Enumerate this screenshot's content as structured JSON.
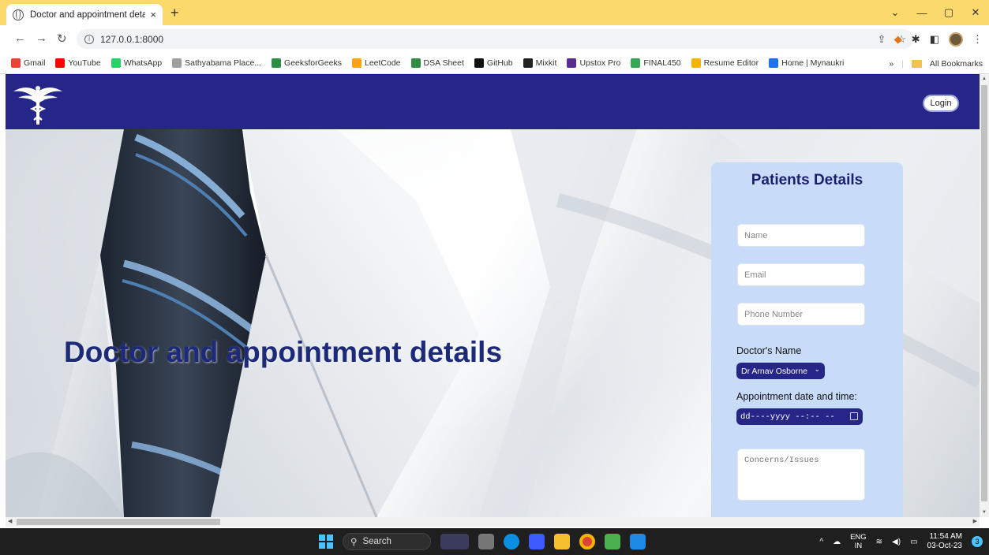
{
  "browser": {
    "tab_title": "Doctor and appointment details",
    "tab_close": "×",
    "new_tab": "+",
    "url": "127.0.0.1:8000",
    "bookmarks": [
      {
        "label": "Gmail",
        "color": "#ea4335"
      },
      {
        "label": "YouTube",
        "color": "#ff0000"
      },
      {
        "label": "WhatsApp",
        "color": "#25d366"
      },
      {
        "label": "Sathyabama Place...",
        "color": "#9e9e9e"
      },
      {
        "label": "GeeksforGeeks",
        "color": "#2f8d46"
      },
      {
        "label": "LeetCode",
        "color": "#ffa116"
      },
      {
        "label": "DSA Sheet",
        "color": "#2f8d46"
      },
      {
        "label": "GitHub",
        "color": "#111111"
      },
      {
        "label": "Mixkit",
        "color": "#222222"
      },
      {
        "label": "Upstox Pro",
        "color": "#5a2d91"
      },
      {
        "label": "FINAL450",
        "color": "#34a853"
      },
      {
        "label": "Resume Editor",
        "color": "#f4b400"
      },
      {
        "label": "Home | Mynaukri",
        "color": "#1a73e8"
      }
    ],
    "more_bookmarks": "»",
    "all_bookmarks": "All Bookmarks"
  },
  "site": {
    "login_label": "Login",
    "hero_title": "Doctor and appointment details",
    "brand_color": "#252687"
  },
  "form": {
    "title": "Patients Details",
    "name_placeholder": "Name",
    "email_placeholder": "Email",
    "phone_placeholder": "Phone Number",
    "doctor_label": "Doctor's Name",
    "doctor_selected": "Dr Arnav Osborne",
    "datetime_label": "Appointment date and time:",
    "datetime_value": "dd----yyyy --:-- --",
    "concerns_placeholder": "Concerns/Issues"
  },
  "taskbar": {
    "search_label": "Search",
    "lang_line1": "ENG",
    "lang_line2": "IN",
    "time": "11:54 AM",
    "date": "03-Oct-23",
    "notification_count": "3"
  }
}
